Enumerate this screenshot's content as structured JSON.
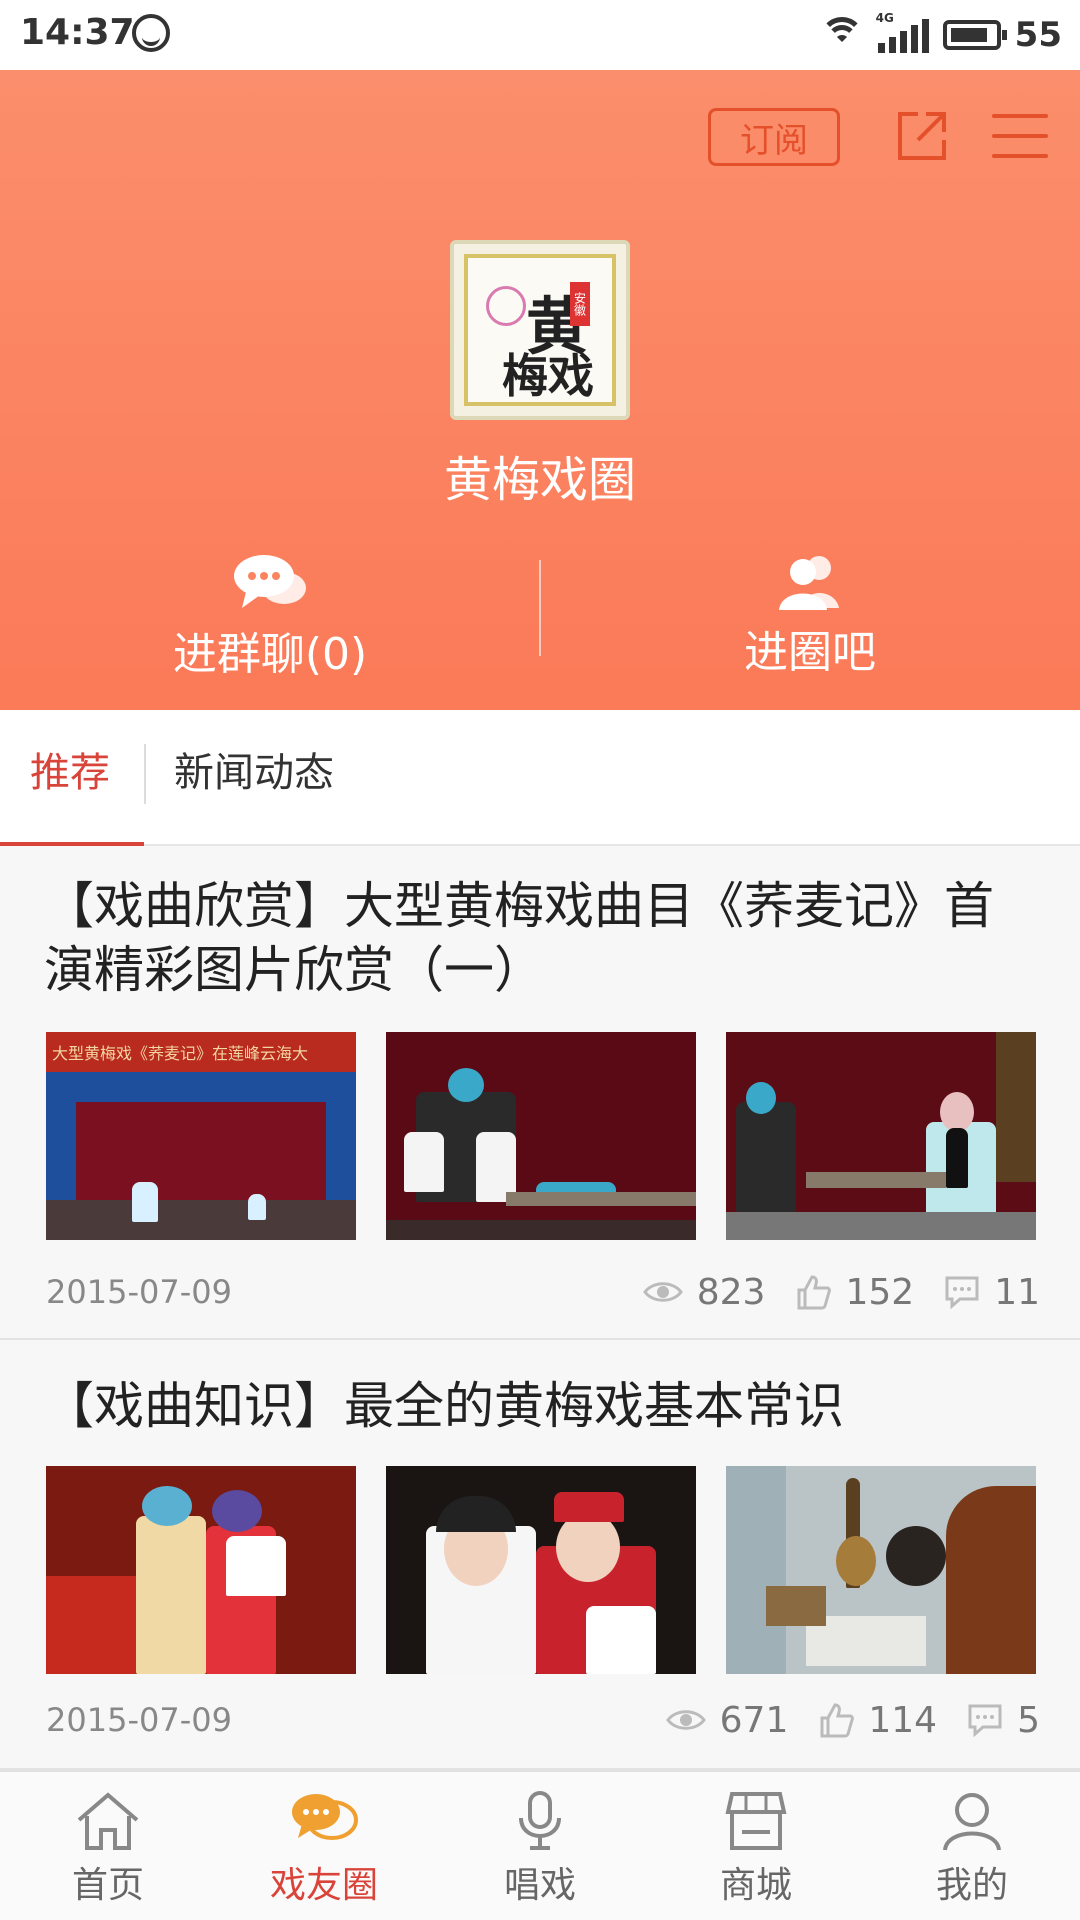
{
  "status_bar": {
    "time": "14:37",
    "network": "4G",
    "battery": "55"
  },
  "header": {
    "subscribe_label": "订阅",
    "logo_glyph_main": "黄",
    "logo_glyph_sub": "梅戏",
    "logo_seal": "安徽",
    "circle_name": "黄梅戏圈",
    "group_chat_label": "进群聊(0)",
    "enter_circle_label": "进圈吧"
  },
  "tabs": [
    {
      "label": "推荐",
      "active": true
    },
    {
      "label": "新闻动态",
      "active": false
    }
  ],
  "feed": [
    {
      "title": "【戏曲欣赏】大型黄梅戏曲目《荞麦记》首演精彩图片欣赏（一）",
      "thumb_banner": "大型黄梅戏《荞麦记》在莲峰云海大",
      "date": "2015-07-09",
      "views": "823",
      "likes": "152",
      "comments": "11"
    },
    {
      "title": "【戏曲知识】最全的黄梅戏基本常识",
      "date": "2015-07-09",
      "views": "671",
      "likes": "114",
      "comments": "5"
    }
  ],
  "bottom_nav": [
    {
      "label": "首页",
      "icon": "home-icon",
      "active": false
    },
    {
      "label": "戏友圈",
      "icon": "chat-bubbles-icon",
      "active": true
    },
    {
      "label": "唱戏",
      "icon": "microphone-icon",
      "active": false
    },
    {
      "label": "商城",
      "icon": "store-icon",
      "active": false
    },
    {
      "label": "我的",
      "icon": "person-icon",
      "active": false
    }
  ],
  "colors": {
    "header_top": "#fb8e6c",
    "header_bottom": "#fb7a58",
    "accent_red": "#d9443a",
    "subscribe_border": "#e4502a",
    "nav_active_icon": "#f0a030"
  }
}
